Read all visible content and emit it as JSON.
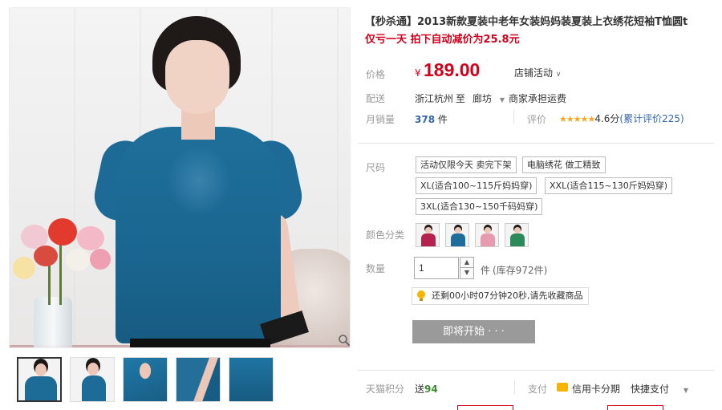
{
  "gallery": {
    "thumbnail_count": 5,
    "zoom_icon": "magnifier-icon"
  },
  "product": {
    "title": "【秒杀通】2013新款夏装中老年女装妈妈装夏装上衣绣花短袖T恤圆t",
    "subtitle": "仅亏一天 拍下自动减价为25.8元"
  },
  "price": {
    "label": "价格",
    "currency": "¥",
    "value": "189.00",
    "promo": "店铺活动",
    "color": "#d3001b"
  },
  "shipping": {
    "label": "配送",
    "from": "浙江杭州",
    "to_word": "至",
    "to": "廊坊",
    "fee": "商家承担运费"
  },
  "sales": {
    "label": "月销量",
    "count": "378",
    "unit": "件",
    "rating_label": "评价",
    "stars": "★★★★★",
    "score": "4.6分",
    "reviews": "(累计评价225)"
  },
  "options": {
    "size_label": "尺码",
    "tags": [
      "活动仅限今天 卖完下架",
      "电脑绣花 做工精致"
    ],
    "sizes": [
      "XL(适合100~115斤妈妈穿)",
      "XXL(适合115~130斤妈妈穿)",
      "3XL(适合130~150千码妈穿)"
    ],
    "color_label": "颜色分类",
    "colors": [
      "#b5224f",
      "#1d6e9b",
      "#e79bb0",
      "#2b8a5a"
    ]
  },
  "quantity": {
    "label": "数量",
    "value": "1",
    "unit": "件",
    "stock": "(库存972件)"
  },
  "countdown": {
    "text": "还剩00小时07分钟20秒,请先收藏商品"
  },
  "cta": {
    "label": "即将开始 · · ·"
  },
  "footer": {
    "points_label": "天猫积分",
    "points_prefix": "送",
    "points_value": "94",
    "pay_label": "支付",
    "installment": "信用卡分期",
    "quick_pay": "快捷支付"
  }
}
